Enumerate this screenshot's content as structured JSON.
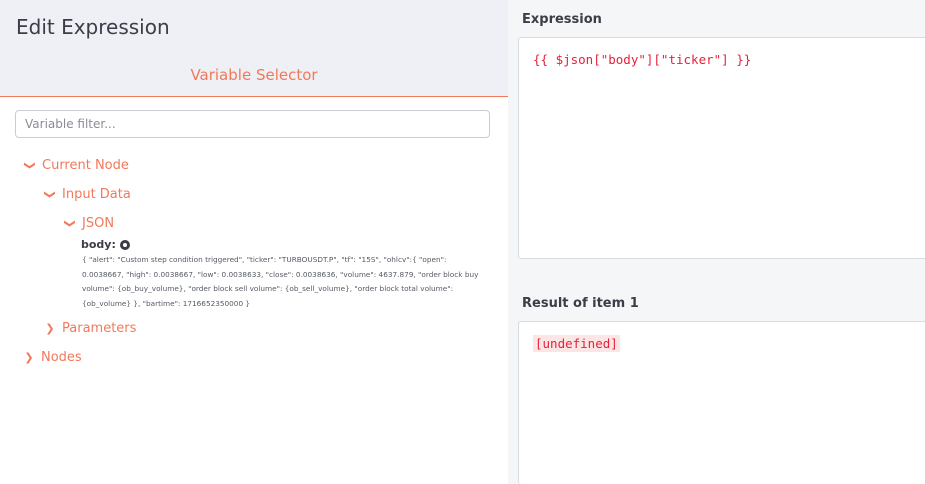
{
  "left": {
    "title": "Edit Expression",
    "section_title": "Variable Selector",
    "filter_placeholder": "Variable filter...",
    "tree": {
      "current_node": "Current Node",
      "input_data": "Input Data",
      "json": "JSON",
      "body_label": "body:",
      "body_value": "{ \"alert\": \"Custom step condition triggered\", \"ticker\": \"TURBOUSDT.P\", \"tf\": \"15S\", \"ohlcv\":{ \"open\": 0.0038667, \"high\": 0.0038667, \"low\": 0.0038633, \"close\": 0.0038636, \"volume\": 4637.879, \"order block buy volume\": {ob_buy_volume}, \"order block sell volume\": {ob_sell_volume}, \"order block total volume\": {ob_volume} }, \"bartime\": 1716652350000 }",
      "parameters": "Parameters",
      "nodes": "Nodes"
    }
  },
  "right": {
    "expression_label": "Expression",
    "expression_value": "{{ $json[\"body\"][\"ticker\"] }}",
    "result_label": "Result of item 1",
    "result_value": "[undefined]"
  },
  "colors": {
    "accent": "#f2785b",
    "header_bg": "#eef0f5",
    "code_red": "#e8213a",
    "text_dark": "#3b3d48"
  },
  "icons": {
    "expanded": "chevron-down-icon",
    "collapsed": "chevron-right-icon",
    "body_marker": "circle-dot-icon"
  }
}
